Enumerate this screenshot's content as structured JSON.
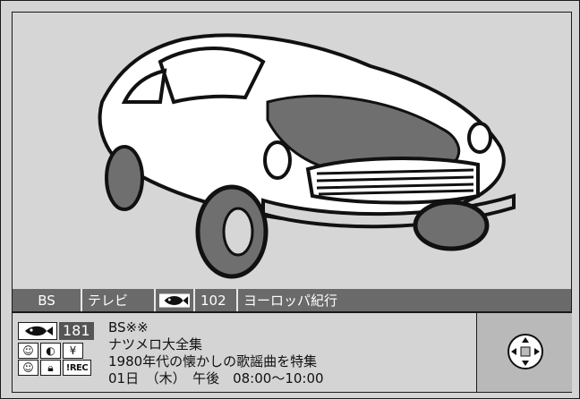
{
  "banner": {
    "band": "BS",
    "type": "テレビ",
    "channel": "102",
    "program": "ヨーロッパ紀行"
  },
  "info": {
    "channel_number": "181",
    "station": "BS※※",
    "title": "ナツメロ大全集",
    "description": "1980年代の懐かしの歌謡曲を特集",
    "datetime": "01日　（木）　午後　08:00～10:00",
    "icons": [
      "smile-icon",
      "half-circle-icon",
      "yen-icon",
      "smile-icon",
      "lock-icon",
      "rec-icon"
    ],
    "yen_label": "¥",
    "rec_label": "!REC"
  },
  "colors": {
    "banner_bg": "#6a6a6a",
    "panel_bg": "#d4d4d4",
    "nav_bg": "#b9b9b9"
  }
}
